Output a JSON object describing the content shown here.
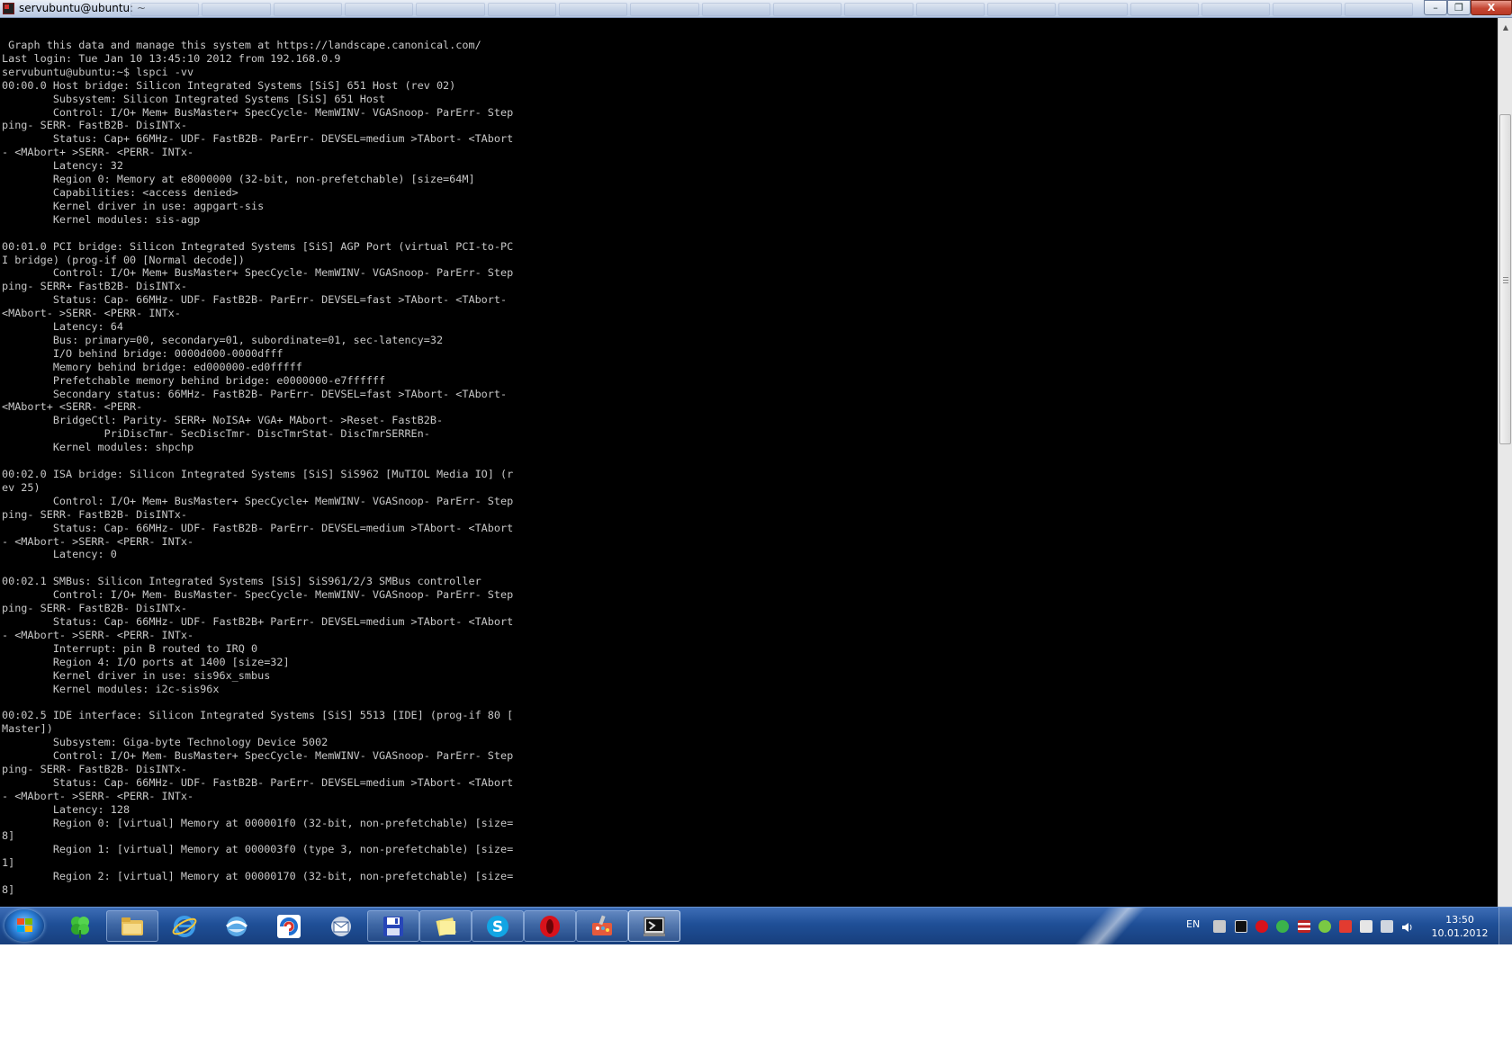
{
  "window": {
    "title": "servubuntu@ubuntu: ~",
    "minimize": "–",
    "maximize": "❐",
    "close": "X"
  },
  "terminal": {
    "lines": [
      " Graph this data and manage this system at https://landscape.canonical.com/",
      "Last login: Tue Jan 10 13:45:10 2012 from 192.168.0.9",
      "servubuntu@ubuntu:~$ lspci -vv",
      "00:00.0 Host bridge: Silicon Integrated Systems [SiS] 651 Host (rev 02)",
      "        Subsystem: Silicon Integrated Systems [SiS] 651 Host",
      "        Control: I/O+ Mem+ BusMaster+ SpecCycle- MemWINV- VGASnoop- ParErr- Step",
      "ping- SERR- FastB2B- DisINTx-",
      "        Status: Cap+ 66MHz- UDF- FastB2B- ParErr- DEVSEL=medium >TAbort- <TAbort",
      "- <MAbort+ >SERR- <PERR- INTx-",
      "        Latency: 32",
      "        Region 0: Memory at e8000000 (32-bit, non-prefetchable) [size=64M]",
      "        Capabilities: <access denied>",
      "        Kernel driver in use: agpgart-sis",
      "        Kernel modules: sis-agp",
      "",
      "00:01.0 PCI bridge: Silicon Integrated Systems [SiS] AGP Port (virtual PCI-to-PC",
      "I bridge) (prog-if 00 [Normal decode])",
      "        Control: I/O+ Mem+ BusMaster+ SpecCycle- MemWINV- VGASnoop- ParErr- Step",
      "ping- SERR+ FastB2B- DisINTx-",
      "        Status: Cap- 66MHz- UDF- FastB2B- ParErr- DEVSEL=fast >TAbort- <TAbort-",
      "<MAbort- >SERR- <PERR- INTx-",
      "        Latency: 64",
      "        Bus: primary=00, secondary=01, subordinate=01, sec-latency=32",
      "        I/O behind bridge: 0000d000-0000dfff",
      "        Memory behind bridge: ed000000-ed0fffff",
      "        Prefetchable memory behind bridge: e0000000-e7ffffff",
      "        Secondary status: 66MHz- FastB2B- ParErr- DEVSEL=fast >TAbort- <TAbort-",
      "<MAbort+ <SERR- <PERR-",
      "        BridgeCtl: Parity- SERR+ NoISA+ VGA+ MAbort- >Reset- FastB2B-",
      "                PriDiscTmr- SecDiscTmr- DiscTmrStat- DiscTmrSERREn-",
      "        Kernel modules: shpchp",
      "",
      "00:02.0 ISA bridge: Silicon Integrated Systems [SiS] SiS962 [MuTIOL Media IO] (r",
      "ev 25)",
      "        Control: I/O+ Mem+ BusMaster+ SpecCycle+ MemWINV- VGASnoop- ParErr- Step",
      "ping- SERR- FastB2B- DisINTx-",
      "        Status: Cap- 66MHz- UDF- FastB2B- ParErr- DEVSEL=medium >TAbort- <TAbort",
      "- <MAbort- >SERR- <PERR- INTx-",
      "        Latency: 0",
      "",
      "00:02.1 SMBus: Silicon Integrated Systems [SiS] SiS961/2/3 SMBus controller",
      "        Control: I/O+ Mem- BusMaster- SpecCycle- MemWINV- VGASnoop- ParErr- Step",
      "ping- SERR- FastB2B- DisINTx-",
      "        Status: Cap- 66MHz- UDF- FastB2B+ ParErr- DEVSEL=medium >TAbort- <TAbort",
      "- <MAbort- >SERR- <PERR- INTx-",
      "        Interrupt: pin B routed to IRQ 0",
      "        Region 4: I/O ports at 1400 [size=32]",
      "        Kernel driver in use: sis96x_smbus",
      "        Kernel modules: i2c-sis96x",
      "",
      "00:02.5 IDE interface: Silicon Integrated Systems [SiS] 5513 [IDE] (prog-if 80 [",
      "Master])",
      "        Subsystem: Giga-byte Technology Device 5002",
      "        Control: I/O+ Mem- BusMaster+ SpecCycle- MemWINV- VGASnoop- ParErr- Step",
      "ping- SERR- FastB2B- DisINTx-",
      "        Status: Cap- 66MHz- UDF- FastB2B- ParErr- DEVSEL=medium >TAbort- <TAbort",
      "- <MAbort- >SERR- <PERR- INTx-",
      "        Latency: 128",
      "        Region 0: [virtual] Memory at 000001f0 (32-bit, non-prefetchable) [size=",
      "8]",
      "        Region 1: [virtual] Memory at 000003f0 (type 3, non-prefetchable) [size=",
      "1]",
      "        Region 2: [virtual] Memory at 00000170 (32-bit, non-prefetchable) [size=",
      "8]"
    ]
  },
  "taskbar": {
    "pinned": [
      {
        "name": "clover-app-icon"
      },
      {
        "name": "file-explorer-icon"
      },
      {
        "name": "internet-explorer-icon"
      },
      {
        "name": "globe-browser-icon"
      },
      {
        "name": "sync-app-icon"
      },
      {
        "name": "mail-app-icon"
      },
      {
        "name": "save-disk-icon"
      },
      {
        "name": "sticky-notes-icon"
      },
      {
        "name": "skype-icon"
      },
      {
        "name": "opera-icon"
      },
      {
        "name": "paint-app-icon"
      },
      {
        "name": "putty-terminal-icon"
      }
    ],
    "language": "EN",
    "time": "13:50",
    "date": "10.01.2012"
  },
  "colors": {
    "terminal_bg": "#000000",
    "terminal_fg": "#c8c8c8",
    "taskbar": "#1f4f97"
  }
}
